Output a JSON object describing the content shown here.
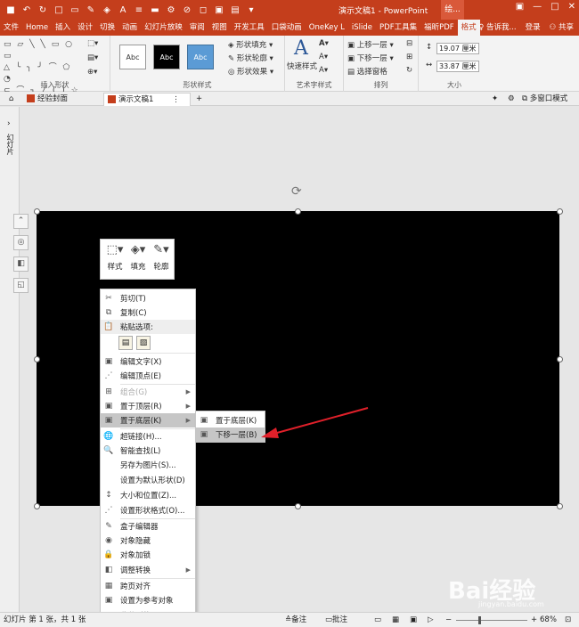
{
  "titlebar": {
    "title": "演示文稿1 - PowerPoint",
    "context_tab": "绘...",
    "qat_icons": [
      "save-icon",
      "undo-icon",
      "redo-icon",
      "new-icon",
      "open-icon",
      "format-painter-icon",
      "fill-icon",
      "font-color-icon",
      "align-icon",
      "ruler-icon",
      "gear-icon",
      "link-icon",
      "shape-icon",
      "group-icon",
      "ungroup-icon",
      "more-icon"
    ]
  },
  "tabs": [
    "文件",
    "Home",
    "插入",
    "设计",
    "切换",
    "动画",
    "幻灯片放映",
    "审阅",
    "视图",
    "开发工具",
    "口袋动画",
    "OneKey L",
    "iSlide",
    "PDF工具集",
    "福昕PDF",
    "格式"
  ],
  "tabs_right": {
    "tell_me": "告诉我...",
    "login": "登录",
    "share": "共享"
  },
  "ribbon": {
    "groups": {
      "insert_shapes": "插入形状",
      "shape_styles": "形状样式",
      "wordart": "艺术字样式",
      "arrange": "排列",
      "size": "大小"
    },
    "style_sample": "Abc",
    "shape_fill": "形状填充",
    "shape_outline": "形状轮廓",
    "shape_effects": "形状效果",
    "quick_styles": "快速样式",
    "bring_forward": "上移一层",
    "send_backward": "下移一层",
    "selection_pane": "选择窗格",
    "height": "19.07 厘米",
    "width": "33.87 厘米"
  },
  "doctabs": {
    "tab1": "经验封面",
    "tab2": "演示文稿1",
    "multi_window": "多窗口模式"
  },
  "left_panel": {
    "label": "幻灯片"
  },
  "mini_toolbar": {
    "style": "样式",
    "fill": "填充",
    "outline": "轮廓"
  },
  "context_menu": {
    "cut": "剪切(T)",
    "copy": "复制(C)",
    "paste_options": "粘贴选项:",
    "edit_text": "编辑文字(X)",
    "edit_points": "编辑顶点(E)",
    "group": "组合(G)",
    "bring_front": "置于顶层(R)",
    "send_back": "置于底层(K)",
    "hyperlink": "超链接(H)...",
    "smart_lookup": "智能查找(L)",
    "save_as_picture": "另存为图片(S)...",
    "set_default": "设置为默认形状(D)",
    "size_position": "大小和位置(Z)...",
    "format_shape": "设置形状格式(O)...",
    "box_editor": "盒子编辑器",
    "object_hide": "对象隐藏",
    "object_lock": "对象加锁",
    "adjust_convert": "调整转换",
    "cross_page_align": "跨页对齐",
    "set_reference": "设置为参考对象",
    "favorite_shape": "收藏形状"
  },
  "submenu": {
    "send_to_back": "置于底层(K)",
    "send_backward": "下移一层(B)"
  },
  "status": {
    "slide_info": "幻灯片 第 1 张，共 1 张",
    "notes": "备注",
    "comments": "批注",
    "zoom": "68%"
  },
  "watermark": {
    "brand": "Bai经验",
    "url": "jingyan.baidu.com"
  },
  "colors": {
    "accent": "#c43e1c",
    "arrow": "#e0202a"
  }
}
